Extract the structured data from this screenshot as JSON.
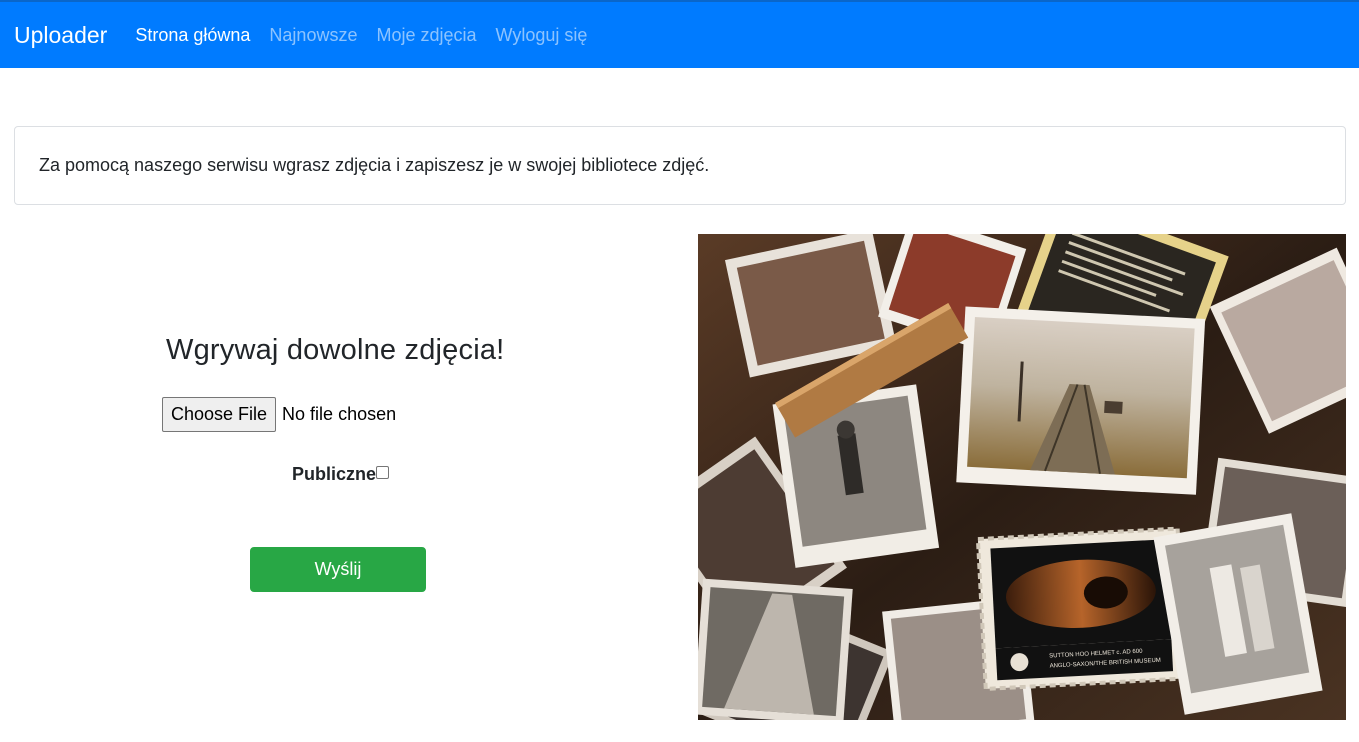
{
  "navbar": {
    "brand": "Uploader",
    "links": [
      {
        "label": "Strona główna",
        "active": true
      },
      {
        "label": "Najnowsze",
        "active": false
      },
      {
        "label": "Moje zdjęcia",
        "active": false
      },
      {
        "label": "Wyloguj się",
        "active": false
      }
    ],
    "color": "#007bff"
  },
  "info": {
    "text": "Za pomocą naszego serwisu wgrasz zdjęcia i zapiszesz je w swojej bibliotece zdjęć."
  },
  "upload": {
    "title": "Wgrywaj dowolne zdjęcia!",
    "file_button": "Choose File",
    "file_status": "No file chosen",
    "public_label": "Publiczne",
    "public_checked": false,
    "submit_label": "Wyślij",
    "submit_color": "#28a745"
  },
  "photo": {
    "stamp_text_line1": "SUTTON HOO HELMET c. AD 600",
    "stamp_text_line2": "ANGLO-SAXON/THE BRITISH MUSEUM"
  }
}
